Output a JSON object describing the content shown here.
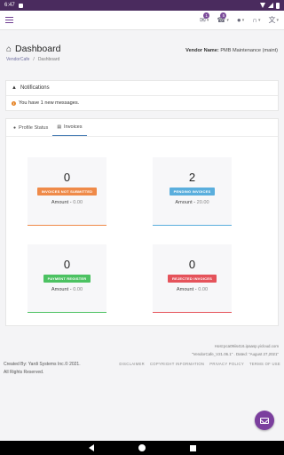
{
  "status_bar": {
    "time": "6:47"
  },
  "topbar": {
    "mail_badge": "1",
    "contacts_badge": "5",
    "mail_caret": "▾",
    "contacts_caret": "▾",
    "user_caret": "▾",
    "support_caret": "▾",
    "language_caret": "▾"
  },
  "header": {
    "title": "Dashboard",
    "vendor_label": "Vendor Name:",
    "vendor_value": "PMB Maintenance (maint)"
  },
  "breadcrumb": {
    "root": "VendorCafe",
    "separator": "/",
    "current": "Dashboard"
  },
  "notifications": {
    "title": "Notifications",
    "message": "You have 1 new messages."
  },
  "tabs": [
    {
      "label": "Profile Status",
      "active": false
    },
    {
      "label": "Invoices",
      "active": true
    }
  ],
  "invoice_stats": [
    {
      "count": "0",
      "label": "INVOICES NOT SUBMITTED",
      "amount_label": "Amount -",
      "amount": "0.00",
      "color": "#ef8a49"
    },
    {
      "count": "2",
      "label": "PENDING INVOICES",
      "amount_label": "Amount -",
      "amount": "20.00",
      "color": "#5aaedd"
    },
    {
      "count": "0",
      "label": "PAYMENT REGISTER",
      "amount_label": "Amount -",
      "amount": "0.00",
      "color": "#4cc262"
    },
    {
      "count": "0",
      "label": "REJECTED INVOICES",
      "amount_label": "Amount -",
      "amount": "0.00",
      "color": "#e5535b"
    }
  ],
  "footer": {
    "host": "Host:pca09iis416.ipaasp.yicloud.com",
    "version": "\"VendorCafe_V21.06.1\" . Dated: \"August 27,2021\"",
    "created_by": "Created By: Yardi Systems Inc.© 2021.",
    "rights": "All Rights Reserved.",
    "links": [
      "DISCLAIMER",
      "COPYRIGHT INFORMATION",
      "PRIVACY POLICY",
      "TERMS OF USE"
    ]
  }
}
